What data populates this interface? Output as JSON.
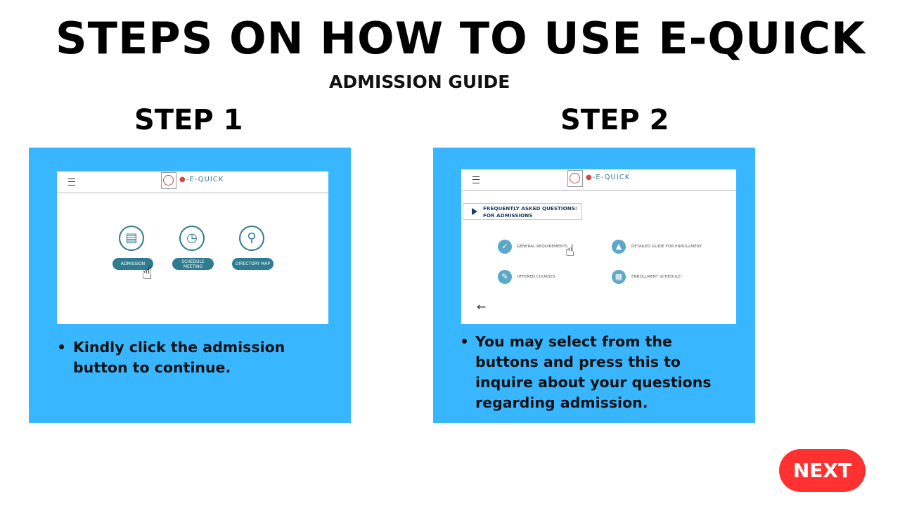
{
  "title": "STEPS ON HOW TO USE E-QUICK",
  "subtitle": "ADMISSION GUIDE",
  "steps": [
    {
      "heading": "STEP 1",
      "screenshot": {
        "logo_text": "E-QUICK",
        "menu_icon": "hamburger-icon",
        "buttons": [
          {
            "label": "ADMISSION",
            "icon": "document-icon"
          },
          {
            "label": "SCHEDULE MEETING",
            "icon": "calendar-clock-icon"
          },
          {
            "label": "DIRECTORY MAP",
            "icon": "map-pin-icon"
          }
        ]
      },
      "instruction": "Kindly click the admission button to continue."
    },
    {
      "heading": "STEP 2",
      "screenshot": {
        "logo_text": "E-QUICK",
        "menu_icon": "hamburger-icon",
        "faq_label_line1": "FREQUENTLY ASKED QUESTIONS:",
        "faq_label_line2": "FOR ADMISSIONS",
        "options": [
          {
            "label": "GENERAL REQUIREMENTS",
            "icon": "check-icon"
          },
          {
            "label": "DETAILED GUIDE FOR ENROLLMENT",
            "icon": "navigation-arrow-icon"
          },
          {
            "label": "OFFERED COURSES",
            "icon": "document-edit-icon"
          },
          {
            "label": "ENROLLMENT SCHEDULE",
            "icon": "calendar-icon"
          }
        ],
        "back_icon": "back-arrow-icon"
      },
      "instruction": "You may select from the buttons and press this to inquire about your questions regarding admission."
    }
  ],
  "next_label": "NEXT",
  "colors": {
    "card_background": "#38b6ff",
    "next_button": "#ff3131",
    "app_teal": "#2f7b8f"
  }
}
